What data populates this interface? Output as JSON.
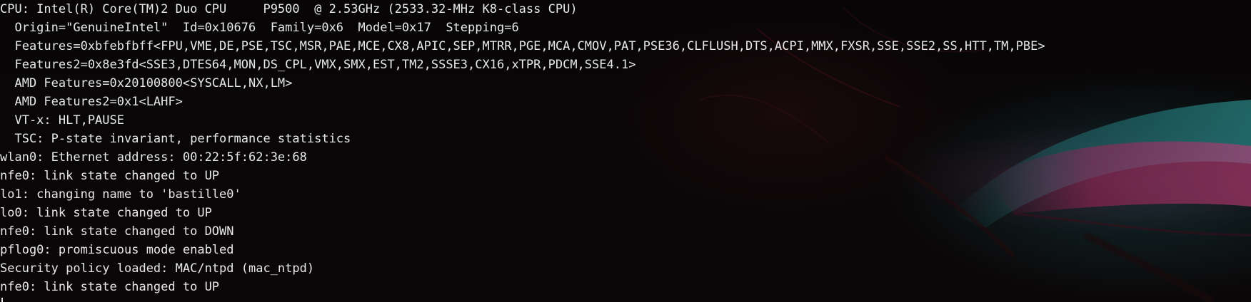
{
  "terminal": {
    "lines": [
      "CPU: Intel(R) Core(TM)2 Duo CPU     P9500  @ 2.53GHz (2533.32-MHz K8-class CPU)",
      "  Origin=\"GenuineIntel\"  Id=0x10676  Family=0x6  Model=0x17  Stepping=6",
      "  Features=0xbfebfbff<FPU,VME,DE,PSE,TSC,MSR,PAE,MCE,CX8,APIC,SEP,MTRR,PGE,MCA,CMOV,PAT,PSE36,CLFLUSH,DTS,ACPI,MMX,FXSR,SSE,SSE2,SS,HTT,TM,PBE>",
      "  Features2=0x8e3fd<SSE3,DTES64,MON,DS_CPL,VMX,SMX,EST,TM2,SSSE3,CX16,xTPR,PDCM,SSE4.1>",
      "  AMD Features=0x20100800<SYSCALL,NX,LM>",
      "  AMD Features2=0x1<LAHF>",
      "  VT-x: HLT,PAUSE",
      "  TSC: P-state invariant, performance statistics",
      "wlan0: Ethernet address: 00:22:5f:62:3e:68",
      "nfe0: link state changed to UP",
      "lo1: changing name to 'bastille0'",
      "lo0: link state changed to UP",
      "nfe0: link state changed to DOWN",
      "pflog0: promiscuous mode enabled",
      "Security policy loaded: MAC/ntpd (mac_ntpd)",
      "nfe0: link state changed to UP"
    ],
    "prompt_text": "",
    "colors": {
      "text": "#e8e8e8",
      "background": "#070506",
      "prompt": "#c1272d"
    }
  }
}
